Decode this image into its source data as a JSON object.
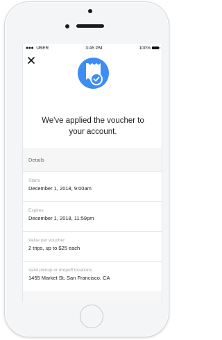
{
  "status_bar": {
    "carrier": "UBER",
    "time": "3:45 PM",
    "battery": "100%"
  },
  "headline": "We've applied the voucher to your account.",
  "details": {
    "section_label": "Details",
    "rows": [
      {
        "label": "Starts",
        "value": "December 1, 2018, 9:00am"
      },
      {
        "label": "Expires",
        "value": "December 1, 2018, 11:59pm"
      },
      {
        "label": "Value per voucher",
        "value": "2 trips, up to $25 each"
      },
      {
        "label": "Valid pickup or dropoff locations",
        "value": "1455 Market St, San Francisco, CA"
      }
    ]
  },
  "colors": {
    "accent": "#3d8df4",
    "text": "#1b1b1b",
    "muted": "#a4a4a4"
  },
  "icons": {
    "close": "close-icon",
    "voucher": "voucher-check-icon"
  }
}
